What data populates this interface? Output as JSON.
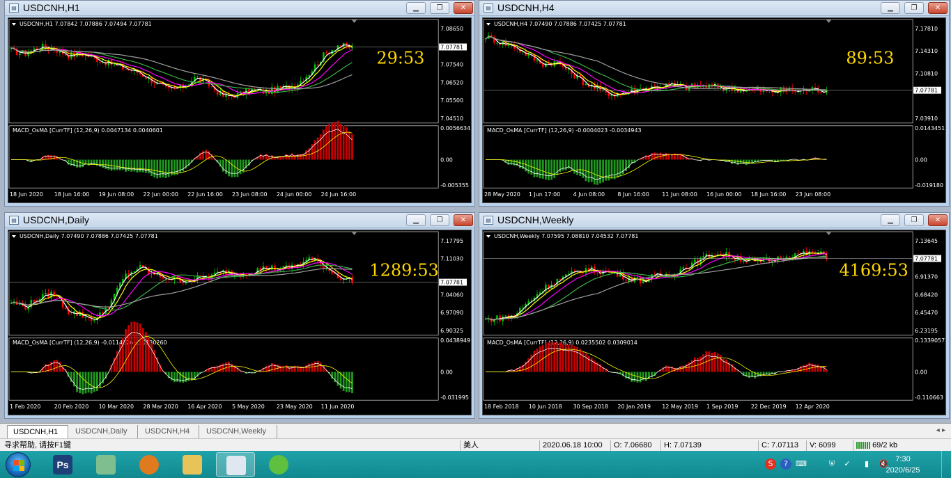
{
  "colors": {
    "up_candle": "#00c000",
    "down_candle": "#ff0000",
    "ma_white": "#ffffff",
    "ma_yellow": "#ffff00",
    "ma_magenta": "#ff00ff",
    "ma_green": "#3cb34a",
    "ma_gray": "#a0a0a0",
    "macd_pos": "#cc0000",
    "macd_neg": "#1f9a1f",
    "timer": "#ffd700",
    "price_line": "#c0c0c0"
  },
  "windows": [
    {
      "id": "h1",
      "title": "USDCNH,H1",
      "info": "USDCNH,H1  7.07842 7.07886 7.07494 7.07781",
      "timer": "29:53",
      "price_labels": [
        "7.08650",
        "7.07781",
        "7.07540",
        "7.06520",
        "7.05500",
        "7.04510"
      ],
      "macd_title": "MACD_OsMA [CurrTF] (12,26,9) 0.0047134 0.0040601",
      "macd_labels": [
        "0.0056634",
        "0.00",
        "-0.005355"
      ],
      "time_labels": [
        "18 Jun 2020",
        "18 Jun 16:00",
        "19 Jun 08:00",
        "22 Jun 00:00",
        "22 Jun 16:00",
        "23 Jun 08:00",
        "24 Jun 00:00",
        "24 Jun 16:00"
      ]
    },
    {
      "id": "h4",
      "title": "USDCNH,H4",
      "info": "USDCNH,H4  7.07490 7.07886 7.07425 7.07781",
      "timer": "89:53",
      "price_labels": [
        "7.17810",
        "7.14310",
        "7.10810",
        "7.07781",
        "7.03910"
      ],
      "macd_title": "MACD_OsMA [CurrTF] (12,26,9) -0.0004023 -0.0034943",
      "macd_labels": [
        "0.0143451",
        "0.00",
        "-0.019180"
      ],
      "time_labels": [
        "28 May 2020",
        "1 Jun 17:00",
        "4 Jun 08:00",
        "8 Jun 16:00",
        "11 Jun 08:00",
        "16 Jun 00:00",
        "18 Jun 16:00",
        "23 Jun 08:00"
      ]
    },
    {
      "id": "daily",
      "title": "USDCNH,Daily",
      "info": "USDCNH,Daily  7.07490 7.07886 7.07425 7.07781",
      "timer": "1289:53",
      "price_labels": [
        "7.17795",
        "7.11030",
        "7.07781",
        "7.04060",
        "6.97090",
        "6.90325"
      ],
      "macd_title": "MACD_OsMA [CurrTF] (12,26,9) -0.0114526 -0.0130260",
      "macd_labels": [
        "0.0438949",
        "0.00",
        "-0.031995"
      ],
      "time_labels": [
        "1 Feb 2020",
        "20 Feb 2020",
        "10 Mar 2020",
        "28 Mar 2020",
        "16 Apr 2020",
        "5 May 2020",
        "23 May 2020",
        "11 Jun 2020"
      ]
    },
    {
      "id": "weekly",
      "title": "USDCNH,Weekly",
      "info": "USDCNH,Weekly  7.07595 7.08810 7.04532 7.07781",
      "timer": "4169:53",
      "price_labels": [
        "7.13645",
        "7.07781",
        "6.91370",
        "6.68420",
        "6.45470",
        "6.23195"
      ],
      "macd_title": "MACD_OsMA [CurrTF] (12,26,9) 0.0235502 0.0309014",
      "macd_labels": [
        "0.1339057",
        "0.00",
        "-0.110663"
      ],
      "time_labels": [
        "18 Feb 2018",
        "10 Jun 2018",
        "30 Sep 2018",
        "20 Jan 2019",
        "12 May 2019",
        "1 Sep 2019",
        "22 Dec 2019",
        "12 Apr 2020"
      ]
    }
  ],
  "window_buttons": {
    "minimize": "▁",
    "restore": "❐",
    "close": "✕"
  },
  "tabs": [
    "USDCNH,H1",
    "USDCNH,Daily",
    "USDCNH,H4",
    "USDCNH,Weekly"
  ],
  "tab_arrows": "◂ ▸",
  "status": {
    "help": "寻求帮助, 请按F1键",
    "profile": "美人",
    "datetime": "2020.06.18 10:00",
    "open": "O: 7.06680",
    "high": "H: 7.07139",
    "close": "C: 7.07113",
    "volume": "V: 6099",
    "traffic": "69/2 kb"
  },
  "taskbar": {
    "apps": [
      {
        "name": "photoshop",
        "label": "Ps",
        "color": "#1f3f78"
      },
      {
        "name": "paint",
        "label": "",
        "color": "#7fbf8f"
      },
      {
        "name": "browser",
        "label": "",
        "color": "#e07a1f"
      },
      {
        "name": "explorer",
        "label": "",
        "color": "#e8c35a"
      },
      {
        "name": "metatrader",
        "label": "",
        "color": "#dfe8f0"
      },
      {
        "name": "wechat",
        "label": "",
        "color": "#5fbf3f"
      }
    ],
    "clock_time": "7:30",
    "clock_date": "2020/6/25"
  }
}
